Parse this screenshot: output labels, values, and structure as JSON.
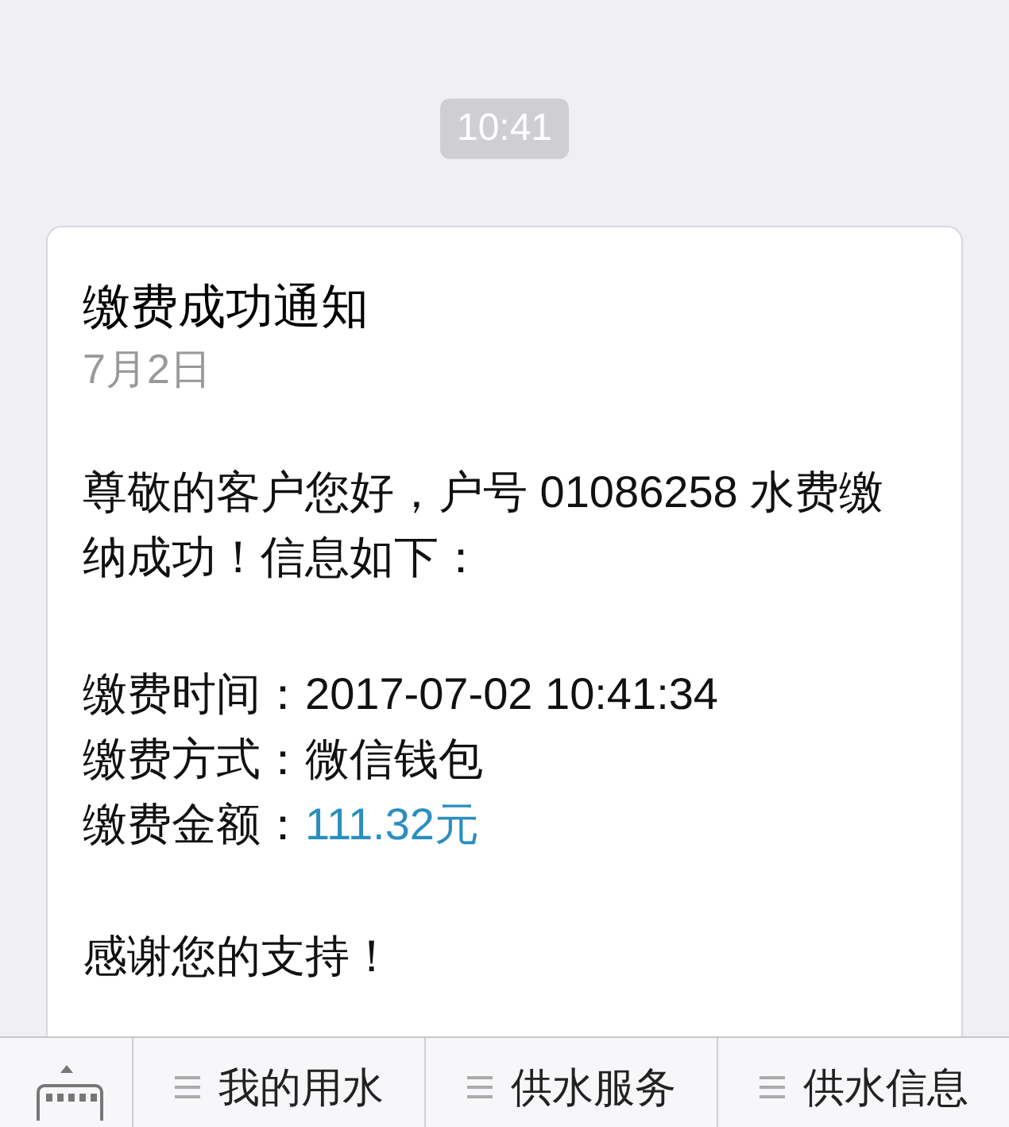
{
  "timestamp": "10:41",
  "message": {
    "title": "缴费成功通知",
    "date": "7月2日",
    "intro": "尊敬的客户您好，户号 01086258 水费缴纳成功！信息如下：",
    "fields": [
      {
        "label": "缴费时间：",
        "value": "2017-07-02 10:41:34",
        "highlight": false
      },
      {
        "label": "缴费方式：",
        "value": "微信钱包",
        "highlight": false
      },
      {
        "label": "缴费金额：",
        "value": "111.32元",
        "highlight": true
      }
    ],
    "closing": "感谢您的支持！"
  },
  "menu": [
    "我的用水",
    "供水服务",
    "供水信息"
  ]
}
